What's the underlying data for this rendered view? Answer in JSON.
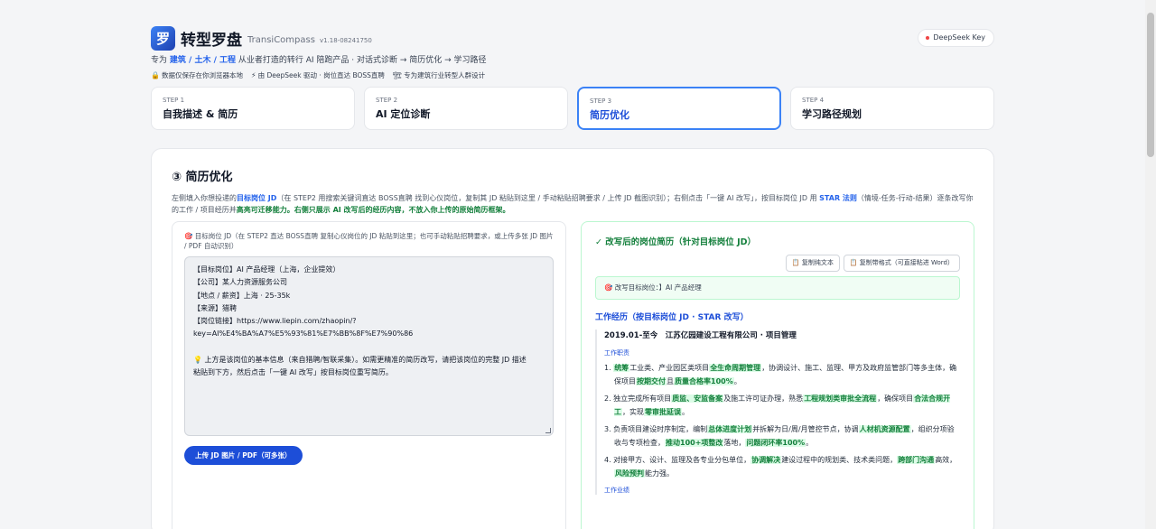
{
  "header": {
    "logo_char": "罗",
    "app_name": "转型罗盘",
    "app_name_en": "TransiCompass",
    "version": "v1.18-08241750",
    "key_button": "DeepSeek Key",
    "tagline_prefix": "专为",
    "tagline_highlight": "建筑 / 土木 / 工程",
    "tagline_suffix": "从业者打造的转行 AI 陪跑产品 · 对话式诊断 → 简历优化 → 学习路径",
    "badges": [
      {
        "icon": "lock-icon",
        "glyph": "🔒",
        "text": "数据仅保存在你浏览器本地"
      },
      {
        "icon": "bolt-icon",
        "glyph": "⚡",
        "text": "由 DeepSeek 驱动 · 岗位直达 BOSS直聘"
      },
      {
        "icon": "building-icon",
        "glyph": "🏗",
        "text": "专为建筑行业转型人群设计"
      }
    ]
  },
  "steps": [
    {
      "num": "STEP 1",
      "title": "自我描述 & 简历"
    },
    {
      "num": "STEP 2",
      "title": "AI 定位诊断"
    },
    {
      "num": "STEP 3",
      "title": "简历优化"
    },
    {
      "num": "STEP 4",
      "title": "学习路径规划"
    }
  ],
  "card": {
    "title": "③ 简历优化",
    "desc_1": "左侧填入你想投递的",
    "desc_2": "目标岗位 JD",
    "desc_3": "（在 STEP2 用搜索关键词直达 BOSS直聘 找到心仪岗位，复制其 JD 粘贴到这里 / 手动粘贴招聘要求 / 上传 JD 截图识别）；右侧点击「一键 AI 改写」，按目标岗位 JD 用",
    "desc_4": "STAR 法则",
    "desc_5": "（情境-任务-行动-结果）逐条改写你的工作 / 项目经历并",
    "desc_6": "高亮可迁移能力。右侧只展示 AI 改写后的经历内容，不放入你上传的原始简历框架。"
  },
  "left": {
    "label_icon": "🎯",
    "label": "目标岗位 JD（在 STEP2 直达 BOSS直聘 复制心仪岗位的 JD 粘贴到这里；也可手动粘贴招聘要求，或上传多张 JD 图片 / PDF 自动识别）",
    "jd_lines": [
      "【目标岗位】AI 产品经理（上海，企业提效）",
      "【公司】某人力资源服务公司",
      "【地点 / 薪资】上海 · 25-35k",
      "【来源】猎聘",
      "【岗位链接】https://www.liepin.com/zhaopin/?",
      "key=AI%E4%BA%A7%E5%93%81%E7%BB%8F%E7%90%86",
      "",
      "💡 上方是该岗位的基本信息（来自猎聘/智联采集）。如需更精准的简历改写，请把该岗位的完整 JD 描述",
      "粘贴到下方，然后点击「一键 AI 改写」按目标岗位重写简历。"
    ],
    "upload_button": "上传 JD 图片 / PDF（可多张）"
  },
  "right": {
    "title": "✓ 改写后的岗位简历（针对目标岗位 JD）",
    "copy_plain": "复制纯文本",
    "copy_format": "复制带格式（可直接粘进 Word）",
    "target": "🎯 改写目标岗位：】AI 产品经理",
    "section_title": "工作经历（按目标岗位 JD · STAR 改写）",
    "experience_head": "2019.01-至今　江苏亿园建设工程有限公司 · 项目管理",
    "duties_label": "工作职责",
    "achievements_label": "工作业绩",
    "duty1": {
      "a": "1. ",
      "h1": "统筹",
      "b": "工业类、产业园区类项目",
      "h2": "全生命周期管理",
      "c": "，协调设计、施工、监理、甲方及政府监管部门等多主体，确保项目",
      "h3": "按期交付",
      "d": "且",
      "h4": "质量合格率100%",
      "e": "。"
    },
    "duty2": {
      "a": "2. 独立完成所有项目",
      "h1": "质监、安监备案",
      "b": "及施工许可证办理，熟悉",
      "h2": "工程规划类审批全流程",
      "c": "，确保项目",
      "h3": "合法合规开工",
      "d": "，实现",
      "h4": "零审批延误",
      "e": "。"
    },
    "duty3": {
      "a": "3. 负责项目建设时序制定，编制",
      "h1": "总体进度计划",
      "b": "并拆解为日/周/月管控节点，协调",
      "h2": "人材机资源配置",
      "c": "，组织分项验收与专项检查，",
      "h3": "推动100+项整改",
      "d": "落地，",
      "h4": "问题闭环率100%",
      "e": "。"
    },
    "duty4": {
      "a": "4. 对接甲方、设计、监理及各专业分包单位，",
      "h1": "协调解决",
      "b": "建设过程中的规划类、技术类问题，",
      "h2": "跨部门沟通",
      "c": "高效，",
      "h3": "风险预判",
      "d": "能力强。"
    }
  }
}
